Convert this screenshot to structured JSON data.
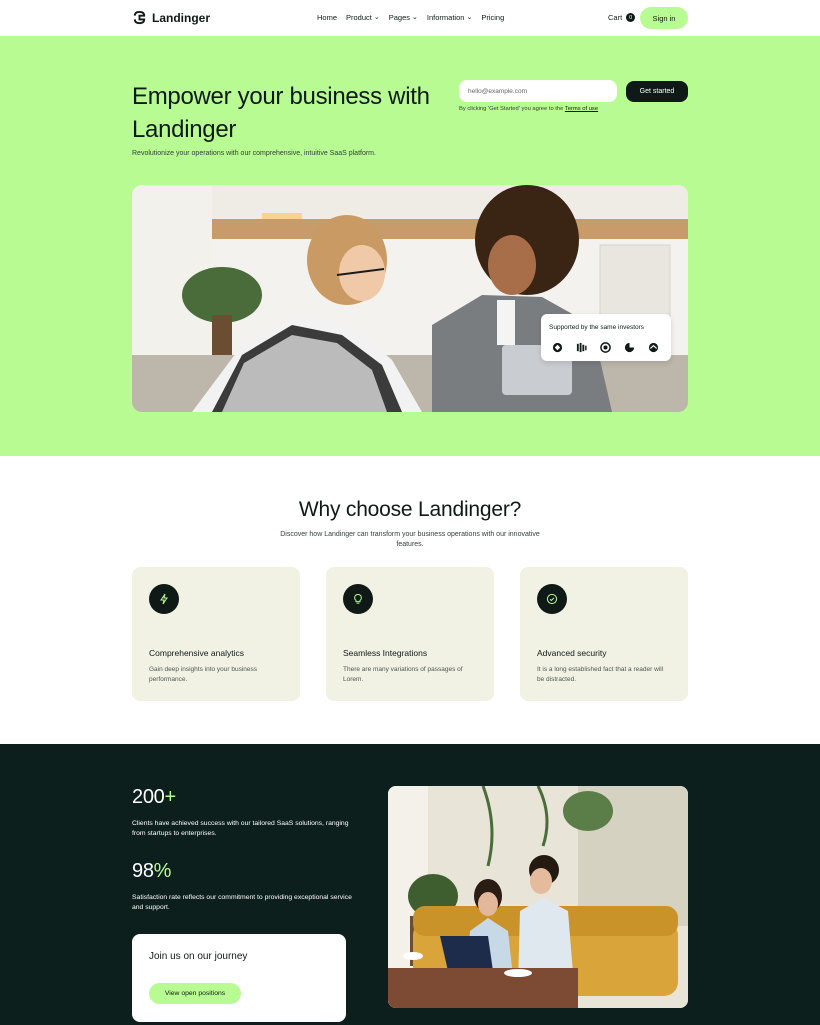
{
  "nav": {
    "brand": "Landinger",
    "links": [
      {
        "label": "Home",
        "dropdown": false
      },
      {
        "label": "Product",
        "dropdown": true
      },
      {
        "label": "Pages",
        "dropdown": true
      },
      {
        "label": "Information",
        "dropdown": true
      },
      {
        "label": "Pricing",
        "dropdown": false
      }
    ],
    "cart_label": "Cart",
    "cart_count": "0",
    "signin_label": "Sign in"
  },
  "hero": {
    "title": "Empower your business with Landinger",
    "subtitle": "Revolutionize your operations with our comprehensive, intuitive SaaS platform.",
    "email_placeholder": "hello@example.com",
    "cta_label": "Get started",
    "agree_text": "By clicking 'Get Started' you agree to the ",
    "terms_label": "Terms of use",
    "investors_title": "Supported by the same investors",
    "investor_icons": [
      "investor-logo-1-icon",
      "investor-logo-2-icon",
      "investor-logo-3-icon",
      "investor-logo-4-icon",
      "investor-logo-5-icon"
    ]
  },
  "features": {
    "title": "Why choose Landinger?",
    "subtitle": "Discover how Landinger can transform your business operations with our innovative features.",
    "cards": [
      {
        "title": "Comprehensive analytics",
        "desc": "Gain deep insights into your business performance.",
        "icon": "lightning-icon"
      },
      {
        "title": "Seamless Integrations",
        "desc": "There are many variations of passages of Lorem.",
        "icon": "lightbulb-icon"
      },
      {
        "title": "Advanced security",
        "desc": "It is a long established fact that a reader will be distracted.",
        "icon": "check-circle-icon"
      }
    ]
  },
  "stats": {
    "items": [
      {
        "number": "200",
        "suffix": "+",
        "desc": "Clients have achieved success with our tailored SaaS solutions, ranging from startups to enterprises."
      },
      {
        "number": "98",
        "suffix": "%",
        "desc": "Satisfaction rate reflects our commitment to providing exceptional service and support."
      }
    ],
    "join_title": "Join us on our journey",
    "join_button": "View open positions"
  },
  "colors": {
    "accent": "#b8fb93",
    "dark": "#0d1f1c",
    "card_bg": "#f1f1e4"
  }
}
